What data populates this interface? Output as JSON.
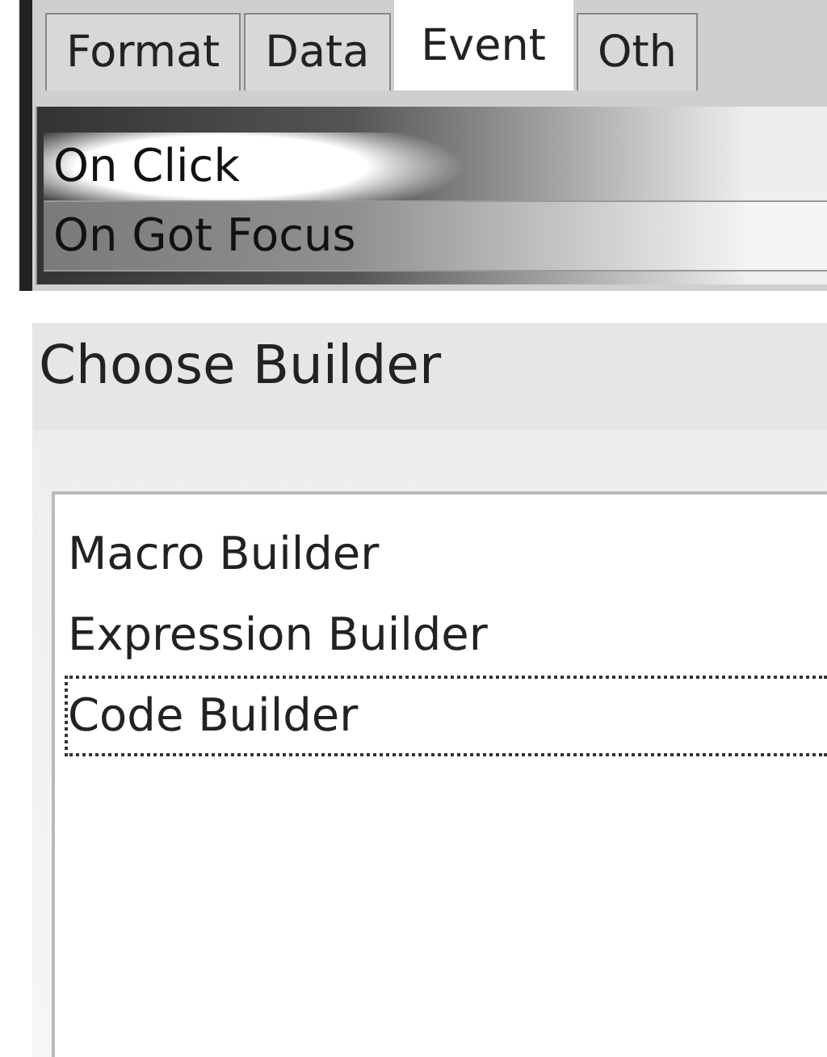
{
  "property_sheet": {
    "tabs": [
      {
        "label": "Format",
        "selected": false
      },
      {
        "label": "Data",
        "selected": false
      },
      {
        "label": "Event",
        "selected": true
      },
      {
        "label": "Oth",
        "selected": false
      }
    ],
    "properties": [
      {
        "label": "On Click",
        "highlighted": true
      },
      {
        "label": "On Got Focus",
        "highlighted": false
      }
    ]
  },
  "dialog": {
    "title": "Choose Builder",
    "items": [
      {
        "label": "Macro Builder",
        "focused": false
      },
      {
        "label": "Expression Builder",
        "focused": false
      },
      {
        "label": "Code Builder",
        "focused": true
      }
    ]
  }
}
